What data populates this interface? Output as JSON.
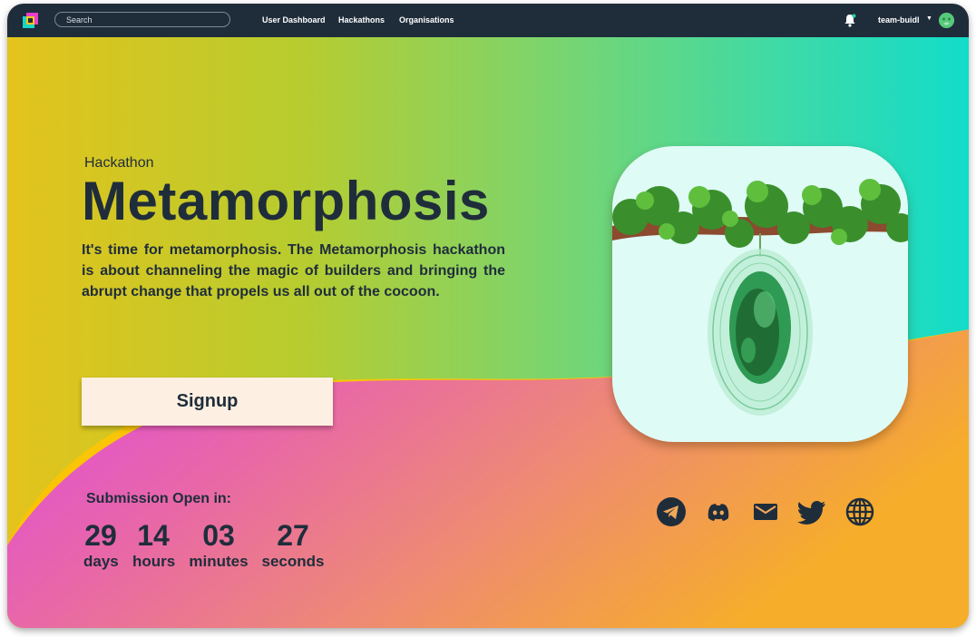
{
  "navbar": {
    "search_placeholder": "Search",
    "links": [
      "User Dashboard",
      "Hackathons",
      "Organisations"
    ],
    "username": "team-buidl"
  },
  "hero": {
    "kicker": "Hackathon",
    "title": "Metamorphosis",
    "description": "It's time for metamorphosis. The Metamorphosis hackathon is about channeling the magic of builders and bringing the abrupt change that propels us all out of the cocoon.",
    "signup_label": "Signup",
    "submission_label": "Submission Open in:",
    "countdown": [
      {
        "value": "29",
        "unit": "days"
      },
      {
        "value": "14",
        "unit": "hours"
      },
      {
        "value": "03",
        "unit": "minutes"
      },
      {
        "value": "27",
        "unit": "seconds"
      }
    ]
  },
  "social_icons": [
    "telegram-icon",
    "discord-icon",
    "email-icon",
    "twitter-icon",
    "globe-icon"
  ],
  "colors": {
    "navbar": "#1f2d3b",
    "text_dark": "#1f2d3b",
    "signup_bg": "#fdefe1",
    "gradient_top_left": "#e2c21c",
    "gradient_top_right": "#15dcc6",
    "gradient_bottom_left": "#e048e4",
    "gradient_bottom_right": "#f6ad2c"
  }
}
